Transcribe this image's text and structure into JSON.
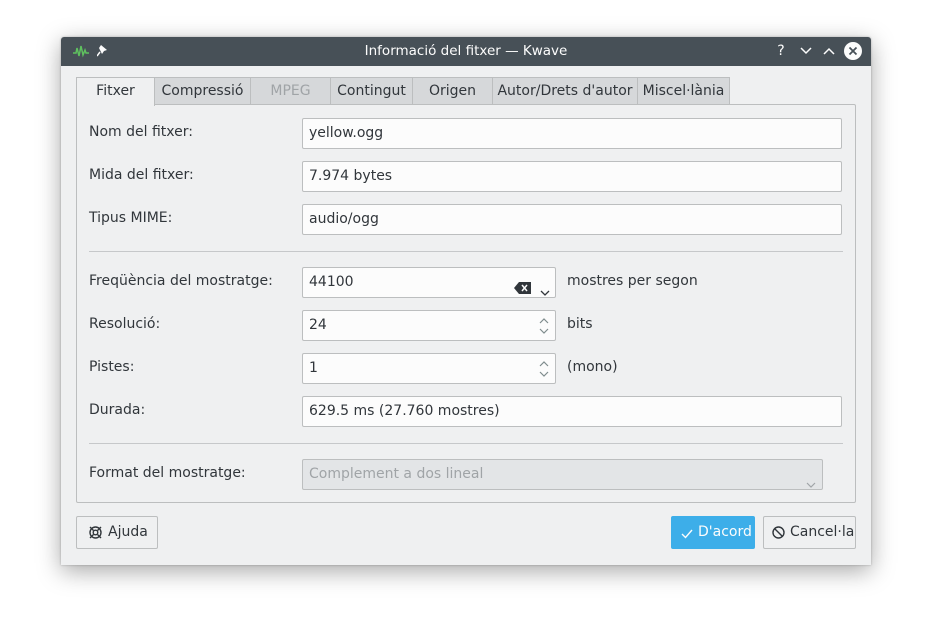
{
  "window": {
    "title": "Informació del fitxer — Kwave",
    "controls": {
      "help": "?",
      "minimize": "﹀",
      "maximize": "︿"
    }
  },
  "tabs": [
    {
      "label": "Fitxer",
      "state": "active"
    },
    {
      "label": "Compressió",
      "state": "normal"
    },
    {
      "label": "MPEG",
      "state": "disabled"
    },
    {
      "label": "Contingut",
      "state": "normal"
    },
    {
      "label": "Origen",
      "state": "normal"
    },
    {
      "label": "Autor/Drets d'autor",
      "state": "normal"
    },
    {
      "label": "Miscel·lània",
      "state": "normal"
    }
  ],
  "form": {
    "filename": {
      "label": "Nom del fitxer:",
      "value": "yellow.ogg"
    },
    "filesize": {
      "label": "Mida del fitxer:",
      "value": "7.974 bytes"
    },
    "mime": {
      "label": "Tipus MIME:",
      "value": "audio/ogg"
    },
    "samplerate": {
      "label": "Freqüència del mostratge:",
      "value": "44100",
      "suffix": "mostres per segon"
    },
    "resolution": {
      "label": "Resolució:",
      "value": "24",
      "suffix": "bits"
    },
    "tracks": {
      "label": "Pistes:",
      "value": "1",
      "suffix": "(mono)"
    },
    "duration": {
      "label": "Durada:",
      "value": "629.5 ms (27.760 mostres)"
    },
    "sampleformat": {
      "label": "Format del mostratge:",
      "value": "Complement a dos lineal"
    }
  },
  "buttons": {
    "help": "Ajuda",
    "ok": "D'acord",
    "cancel": "Cancel·la"
  },
  "colors": {
    "titlebar": "#475057",
    "accent": "#3daee9",
    "background": "#eff0f1"
  }
}
